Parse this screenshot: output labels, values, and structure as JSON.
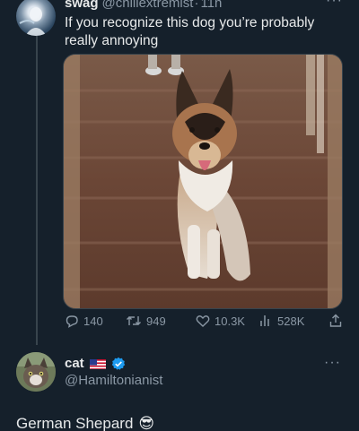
{
  "tweet": {
    "author_name": "swag",
    "author_handle": "@chillextremist",
    "separator": "·",
    "time": "11h",
    "more": "···",
    "text": "If you recognize this dog you’re probably really annoying",
    "media_alt": "german-shepherd-running-down-hallway",
    "stats": {
      "replies": "140",
      "retweets": "949",
      "likes": "10.3K",
      "views": "528K"
    }
  },
  "reply": {
    "author_name": "cat",
    "author_handle": "@Hamiltonianist",
    "more": "···",
    "text": "German Shepard",
    "emoji": "😎"
  },
  "colors": {
    "background": "#15202b",
    "text_primary": "#e7e9ea",
    "text_secondary": "#8b98a5",
    "verified": "#1d9bf0",
    "divider": "#38444d"
  }
}
